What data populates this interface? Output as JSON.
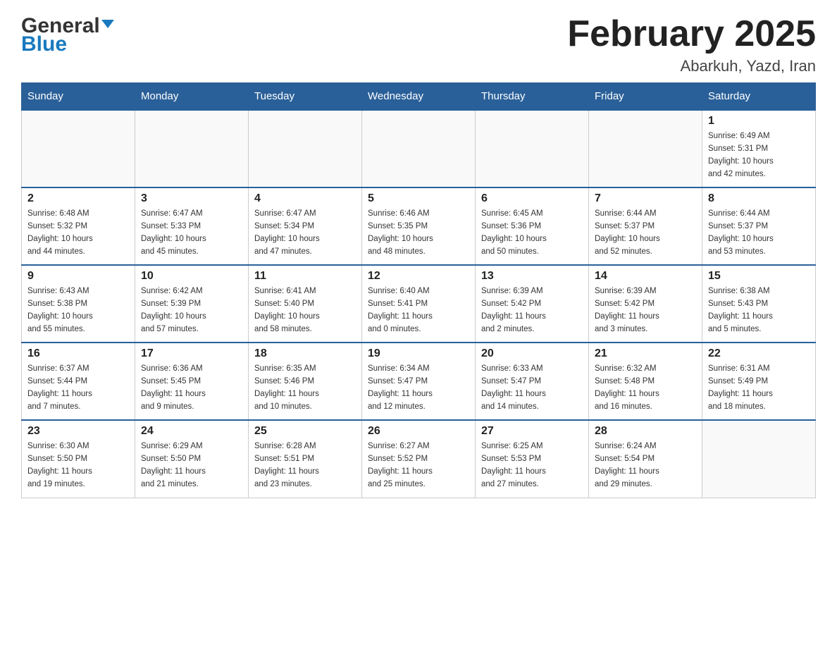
{
  "header": {
    "logo_general": "General",
    "logo_blue": "Blue",
    "month_title": "February 2025",
    "location": "Abarkuh, Yazd, Iran"
  },
  "weekdays": [
    "Sunday",
    "Monday",
    "Tuesday",
    "Wednesday",
    "Thursday",
    "Friday",
    "Saturday"
  ],
  "weeks": [
    [
      {
        "day": "",
        "info": ""
      },
      {
        "day": "",
        "info": ""
      },
      {
        "day": "",
        "info": ""
      },
      {
        "day": "",
        "info": ""
      },
      {
        "day": "",
        "info": ""
      },
      {
        "day": "",
        "info": ""
      },
      {
        "day": "1",
        "info": "Sunrise: 6:49 AM\nSunset: 5:31 PM\nDaylight: 10 hours\nand 42 minutes."
      }
    ],
    [
      {
        "day": "2",
        "info": "Sunrise: 6:48 AM\nSunset: 5:32 PM\nDaylight: 10 hours\nand 44 minutes."
      },
      {
        "day": "3",
        "info": "Sunrise: 6:47 AM\nSunset: 5:33 PM\nDaylight: 10 hours\nand 45 minutes."
      },
      {
        "day": "4",
        "info": "Sunrise: 6:47 AM\nSunset: 5:34 PM\nDaylight: 10 hours\nand 47 minutes."
      },
      {
        "day": "5",
        "info": "Sunrise: 6:46 AM\nSunset: 5:35 PM\nDaylight: 10 hours\nand 48 minutes."
      },
      {
        "day": "6",
        "info": "Sunrise: 6:45 AM\nSunset: 5:36 PM\nDaylight: 10 hours\nand 50 minutes."
      },
      {
        "day": "7",
        "info": "Sunrise: 6:44 AM\nSunset: 5:37 PM\nDaylight: 10 hours\nand 52 minutes."
      },
      {
        "day": "8",
        "info": "Sunrise: 6:44 AM\nSunset: 5:37 PM\nDaylight: 10 hours\nand 53 minutes."
      }
    ],
    [
      {
        "day": "9",
        "info": "Sunrise: 6:43 AM\nSunset: 5:38 PM\nDaylight: 10 hours\nand 55 minutes."
      },
      {
        "day": "10",
        "info": "Sunrise: 6:42 AM\nSunset: 5:39 PM\nDaylight: 10 hours\nand 57 minutes."
      },
      {
        "day": "11",
        "info": "Sunrise: 6:41 AM\nSunset: 5:40 PM\nDaylight: 10 hours\nand 58 minutes."
      },
      {
        "day": "12",
        "info": "Sunrise: 6:40 AM\nSunset: 5:41 PM\nDaylight: 11 hours\nand 0 minutes."
      },
      {
        "day": "13",
        "info": "Sunrise: 6:39 AM\nSunset: 5:42 PM\nDaylight: 11 hours\nand 2 minutes."
      },
      {
        "day": "14",
        "info": "Sunrise: 6:39 AM\nSunset: 5:42 PM\nDaylight: 11 hours\nand 3 minutes."
      },
      {
        "day": "15",
        "info": "Sunrise: 6:38 AM\nSunset: 5:43 PM\nDaylight: 11 hours\nand 5 minutes."
      }
    ],
    [
      {
        "day": "16",
        "info": "Sunrise: 6:37 AM\nSunset: 5:44 PM\nDaylight: 11 hours\nand 7 minutes."
      },
      {
        "day": "17",
        "info": "Sunrise: 6:36 AM\nSunset: 5:45 PM\nDaylight: 11 hours\nand 9 minutes."
      },
      {
        "day": "18",
        "info": "Sunrise: 6:35 AM\nSunset: 5:46 PM\nDaylight: 11 hours\nand 10 minutes."
      },
      {
        "day": "19",
        "info": "Sunrise: 6:34 AM\nSunset: 5:47 PM\nDaylight: 11 hours\nand 12 minutes."
      },
      {
        "day": "20",
        "info": "Sunrise: 6:33 AM\nSunset: 5:47 PM\nDaylight: 11 hours\nand 14 minutes."
      },
      {
        "day": "21",
        "info": "Sunrise: 6:32 AM\nSunset: 5:48 PM\nDaylight: 11 hours\nand 16 minutes."
      },
      {
        "day": "22",
        "info": "Sunrise: 6:31 AM\nSunset: 5:49 PM\nDaylight: 11 hours\nand 18 minutes."
      }
    ],
    [
      {
        "day": "23",
        "info": "Sunrise: 6:30 AM\nSunset: 5:50 PM\nDaylight: 11 hours\nand 19 minutes."
      },
      {
        "day": "24",
        "info": "Sunrise: 6:29 AM\nSunset: 5:50 PM\nDaylight: 11 hours\nand 21 minutes."
      },
      {
        "day": "25",
        "info": "Sunrise: 6:28 AM\nSunset: 5:51 PM\nDaylight: 11 hours\nand 23 minutes."
      },
      {
        "day": "26",
        "info": "Sunrise: 6:27 AM\nSunset: 5:52 PM\nDaylight: 11 hours\nand 25 minutes."
      },
      {
        "day": "27",
        "info": "Sunrise: 6:25 AM\nSunset: 5:53 PM\nDaylight: 11 hours\nand 27 minutes."
      },
      {
        "day": "28",
        "info": "Sunrise: 6:24 AM\nSunset: 5:54 PM\nDaylight: 11 hours\nand 29 minutes."
      },
      {
        "day": "",
        "info": ""
      }
    ]
  ]
}
